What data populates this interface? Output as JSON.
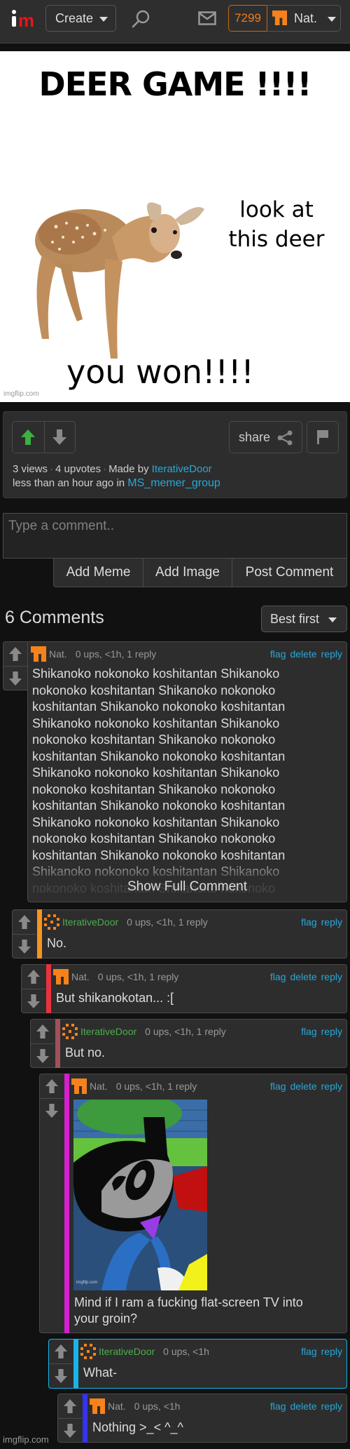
{
  "header": {
    "logo_text": "im",
    "create_label": "Create",
    "points": "7299",
    "username": "Nat.",
    "icons": [
      "search-icon",
      "mail-icon",
      "user-avatar-icon",
      "chevron-down-icon"
    ]
  },
  "meme": {
    "title": "DEER GAME !!!!",
    "side_text_line1": "look at",
    "side_text_line2": "this deer",
    "bottom_text": "you won!!!!",
    "watermark": "imgflip.com"
  },
  "post": {
    "views": "3 views",
    "upvotes": "4 upvotes",
    "made_by_label": "Made by",
    "author": "IterativeDoor",
    "time": "less than an hour ago in",
    "stream": "MS_memer_group",
    "share_label": "share",
    "upvoted": true,
    "colors": {
      "upvote_active": "#3cb043",
      "link": "#28a8d8"
    }
  },
  "comment_form": {
    "placeholder": "Type a comment..",
    "value": "",
    "buttons": [
      "Add Meme",
      "Add Image",
      "Post Comment"
    ]
  },
  "comments_header": {
    "count_label": "6 Comments",
    "sort_label": "Best first"
  },
  "comments": [
    {
      "user": "Nat.",
      "meta": "0 ups, <1h, 1 reply",
      "actions": [
        "flag",
        "delete",
        "reply"
      ],
      "lines": [
        "Shikanoko nokonoko koshitantan Shikanoko",
        "nokonoko koshitantan Shikanoko nokonoko",
        "koshitantan Shikanoko nokonoko koshitantan",
        "Shikanoko nokonoko koshitantan Shikanoko",
        "nokonoko koshitantan Shikanoko nokonoko",
        "koshitantan Shikanoko nokonoko koshitantan",
        "Shikanoko nokonoko koshitantan Shikanoko",
        "nokonoko koshitantan Shikanoko nokonoko",
        "koshitantan Shikanoko nokonoko koshitantan",
        "Shikanoko nokonoko koshitantan Shikanoko",
        "nokonoko koshitantan Shikanoko nokonoko",
        "koshitantan Shikanoko nokonoko koshitantan",
        "Shikanoko nokonoko koshitantan Shikanoko",
        "nokonoko koshitantan Shikanoko nokonoko"
      ],
      "show_full_label": "Show Full Comment",
      "bar_color": null
    },
    {
      "user": "IterativeDoor",
      "meta": "0 ups, <1h, 1 reply",
      "actions": [
        "flag",
        "reply"
      ],
      "text": "No.",
      "bar_color": "#f7941d"
    },
    {
      "user": "Nat.",
      "meta": "0 ups, <1h, 1 reply",
      "actions": [
        "flag",
        "delete",
        "reply"
      ],
      "text": "But shikanokotan... :[",
      "bar_color": "#e8323c"
    },
    {
      "user": "IterativeDoor",
      "meta": "0 ups, <1h, 1 reply",
      "actions": [
        "flag",
        "reply"
      ],
      "text": "But no.",
      "bar_color": "#a0525a"
    },
    {
      "user": "Nat.",
      "meta": "0 ups, <1h, 1 reply",
      "actions": [
        "flag",
        "delete",
        "reply"
      ],
      "image_watermark": "imgflip.com",
      "text_line1": "Mind if I ram a fucking flat-screen TV into",
      "text_line2": "your groin?",
      "bar_color": "#d61fcf"
    },
    {
      "user": "IterativeDoor",
      "meta": "0 ups, <1h",
      "actions": [
        "flag",
        "reply"
      ],
      "text": "What-",
      "bar_color": "#1ab3ea"
    },
    {
      "user": "Nat.",
      "meta": "0 ups, <1h",
      "actions": [
        "flag",
        "delete",
        "reply"
      ],
      "text": "Nothing >_< ^_^",
      "bar_color": "#3434ee"
    }
  ],
  "footer": {
    "watermark": "imgflip.com"
  }
}
